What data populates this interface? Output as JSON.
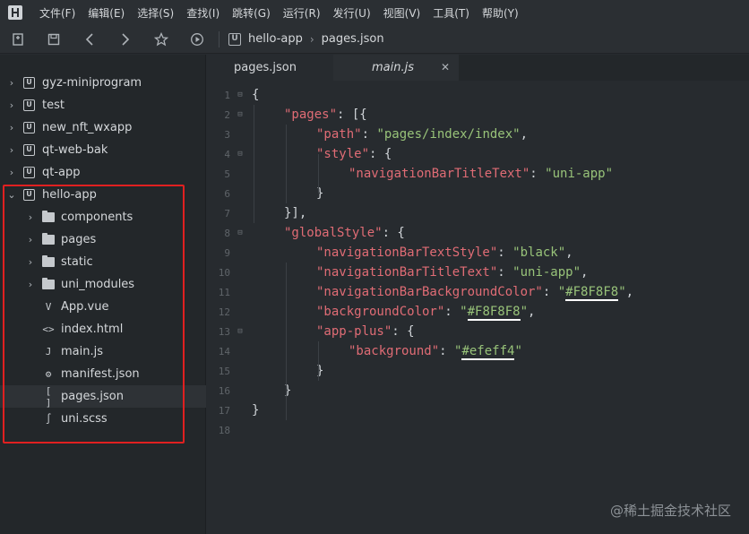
{
  "menu": [
    "文件(F)",
    "编辑(E)",
    "选择(S)",
    "查找(I)",
    "跳转(G)",
    "运行(R)",
    "发行(U)",
    "视图(V)",
    "工具(T)",
    "帮助(Y)"
  ],
  "breadcrumb": {
    "project": "hello-app",
    "file": "pages.json"
  },
  "tree": [
    {
      "label": "gyz-miniprogram",
      "kind": "project",
      "depth": 0,
      "arrow": "›"
    },
    {
      "label": "test",
      "kind": "project",
      "depth": 0,
      "arrow": "›"
    },
    {
      "label": "new_nft_wxapp",
      "kind": "project",
      "depth": 0,
      "arrow": "›"
    },
    {
      "label": "qt-web-bak",
      "kind": "project",
      "depth": 0,
      "arrow": "›"
    },
    {
      "label": "qt-app",
      "kind": "project",
      "depth": 0,
      "arrow": "›"
    },
    {
      "label": "hello-app",
      "kind": "project",
      "depth": 0,
      "arrow": "⌄"
    },
    {
      "label": "components",
      "kind": "folder",
      "depth": 1,
      "arrow": "›"
    },
    {
      "label": "pages",
      "kind": "folder",
      "depth": 1,
      "arrow": "›"
    },
    {
      "label": "static",
      "kind": "folder",
      "depth": 1,
      "arrow": "›"
    },
    {
      "label": "uni_modules",
      "kind": "folder",
      "depth": 1,
      "arrow": "›"
    },
    {
      "label": "App.vue",
      "kind": "file",
      "icon": "V",
      "depth": 1
    },
    {
      "label": "index.html",
      "kind": "file",
      "icon": "<>",
      "depth": 1
    },
    {
      "label": "main.js",
      "kind": "file",
      "icon": "J",
      "depth": 1
    },
    {
      "label": "manifest.json",
      "kind": "file",
      "icon": "⚙",
      "depth": 1
    },
    {
      "label": "pages.json",
      "kind": "file",
      "icon": "[ ]",
      "depth": 1,
      "selected": true
    },
    {
      "label": "uni.scss",
      "kind": "file",
      "icon": "∫",
      "depth": 1
    }
  ],
  "tabs": [
    {
      "label": "pages.json",
      "active": true
    },
    {
      "label": "main.js",
      "active": false
    }
  ],
  "code_lines": [
    {
      "n": "1",
      "fold": "⊟",
      "indent": 0,
      "parts": [
        [
          "p",
          "{"
        ]
      ]
    },
    {
      "n": "2",
      "fold": "⊟",
      "indent": 1,
      "parts": [
        [
          "k",
          "\"pages\""
        ],
        [
          "p",
          ": [{"
        ]
      ]
    },
    {
      "n": "3",
      "fold": "",
      "indent": 2,
      "parts": [
        [
          "k",
          "\"path\""
        ],
        [
          "p",
          ": "
        ],
        [
          "s",
          "\"pages/index/index\""
        ],
        [
          "p",
          ","
        ]
      ]
    },
    {
      "n": "4",
      "fold": "⊟",
      "indent": 2,
      "parts": [
        [
          "k",
          "\"style\""
        ],
        [
          "p",
          ": {"
        ]
      ]
    },
    {
      "n": "5",
      "fold": "",
      "indent": 3,
      "parts": [
        [
          "k",
          "\"navigationBarTitleText\""
        ],
        [
          "p",
          ": "
        ],
        [
          "s",
          "\"uni-app\""
        ]
      ]
    },
    {
      "n": "6",
      "fold": "",
      "indent": 2,
      "parts": [
        [
          "p",
          "}"
        ]
      ]
    },
    {
      "n": "7",
      "fold": "",
      "indent": 1,
      "parts": [
        [
          "p",
          "}],"
        ]
      ]
    },
    {
      "n": "8",
      "fold": "⊟",
      "indent": 1,
      "parts": [
        [
          "k",
          "\"globalStyle\""
        ],
        [
          "p",
          ": {"
        ]
      ]
    },
    {
      "n": "9",
      "fold": "",
      "indent": 2,
      "parts": [
        [
          "k",
          "\"navigationBarTextStyle\""
        ],
        [
          "p",
          ": "
        ],
        [
          "s",
          "\"black\""
        ],
        [
          "p",
          ","
        ]
      ]
    },
    {
      "n": "10",
      "fold": "",
      "indent": 2,
      "parts": [
        [
          "k",
          "\"navigationBarTitleText\""
        ],
        [
          "p",
          ": "
        ],
        [
          "s",
          "\"uni-app\""
        ],
        [
          "p",
          ","
        ]
      ]
    },
    {
      "n": "11",
      "fold": "",
      "indent": 2,
      "parts": [
        [
          "k",
          "\"navigationBarBackgroundColor\""
        ],
        [
          "p",
          ": "
        ],
        [
          "s",
          "\""
        ],
        [
          "cv",
          "#F8F8F8"
        ],
        [
          "s",
          "\""
        ],
        [
          "p",
          ","
        ]
      ]
    },
    {
      "n": "12",
      "fold": "",
      "indent": 2,
      "parts": [
        [
          "k",
          "\"backgroundColor\""
        ],
        [
          "p",
          ": "
        ],
        [
          "s",
          "\""
        ],
        [
          "cv",
          "#F8F8F8"
        ],
        [
          "s",
          "\""
        ],
        [
          "p",
          ","
        ]
      ]
    },
    {
      "n": "13",
      "fold": "⊟",
      "indent": 2,
      "parts": [
        [
          "k",
          "\"app-plus\""
        ],
        [
          "p",
          ": {"
        ]
      ]
    },
    {
      "n": "14",
      "fold": "",
      "indent": 3,
      "parts": [
        [
          "k",
          "\"background\""
        ],
        [
          "p",
          ": "
        ],
        [
          "s",
          "\""
        ],
        [
          "cv",
          "#efeff4"
        ],
        [
          "s",
          "\""
        ]
      ]
    },
    {
      "n": "15",
      "fold": "",
      "indent": 2,
      "parts": [
        [
          "p",
          "}"
        ]
      ]
    },
    {
      "n": "16",
      "fold": "",
      "indent": 1,
      "parts": [
        [
          "p",
          "}"
        ]
      ]
    },
    {
      "n": "17",
      "fold": "",
      "indent": 0,
      "parts": [
        [
          "p",
          "}"
        ]
      ]
    },
    {
      "n": "18",
      "fold": "",
      "indent": 0,
      "parts": []
    }
  ],
  "watermark": "@稀土掘金技术社区",
  "colors": {
    "key": "#e06c75",
    "string": "#98c379",
    "highlight_box": "#e02020"
  },
  "icons": [
    "hbuilder-logo-icon",
    "new-file-icon",
    "save-icon",
    "back-icon",
    "forward-icon",
    "star-icon",
    "run-icon",
    "project-icon",
    "folder-icon",
    "close-icon"
  ]
}
